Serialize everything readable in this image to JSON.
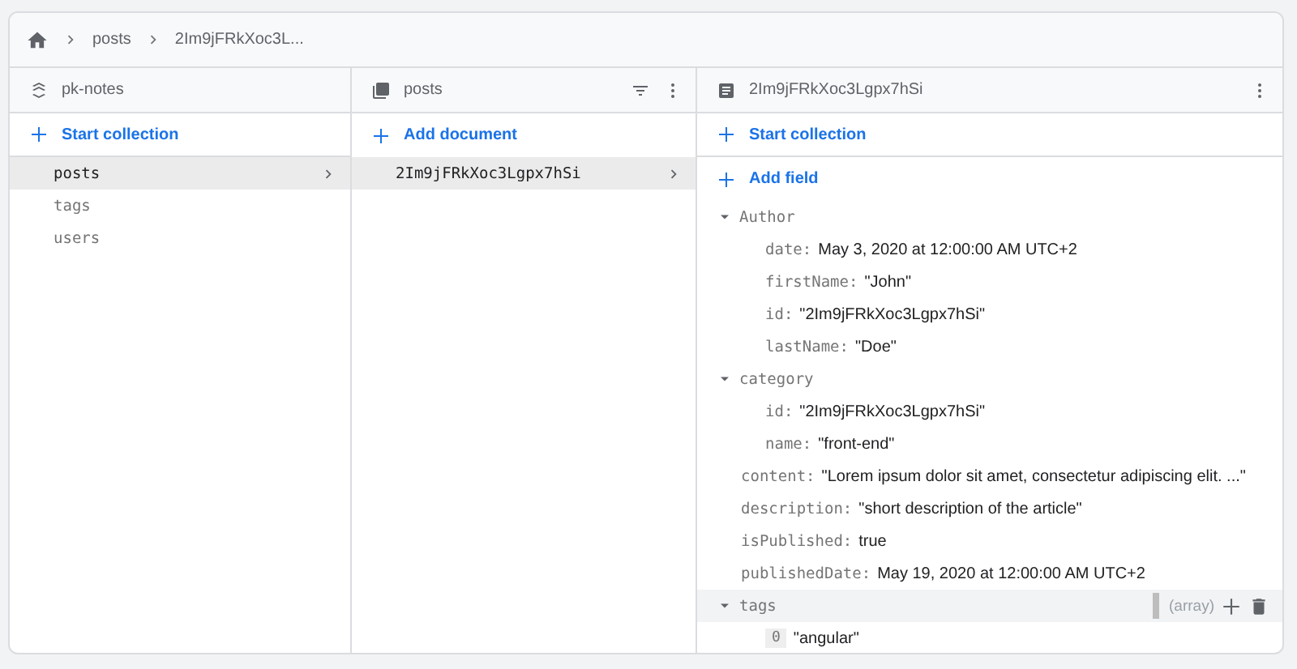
{
  "breadcrumb": [
    "posts",
    "2Im9jFRkXoc3L..."
  ],
  "root_panel": {
    "title": "pk-notes",
    "action": "Start collection",
    "items": [
      {
        "label": "posts",
        "selected": true
      },
      {
        "label": "tags",
        "selected": false
      },
      {
        "label": "users",
        "selected": false
      }
    ]
  },
  "collection_panel": {
    "title": "posts",
    "action": "Add document",
    "items": [
      {
        "label": "2Im9jFRkXoc3Lgpx7hSi",
        "selected": true
      }
    ]
  },
  "document_panel": {
    "title": "2Im9jFRkXoc3Lgpx7hSi",
    "collection_action": "Start collection",
    "field_action": "Add field",
    "fields": [
      {
        "key": "Author",
        "kind": "map",
        "expanded": true,
        "hovered": false,
        "children": [
          {
            "key": "date:",
            "value": "May 3, 2020 at 12:00:00 AM UTC+2"
          },
          {
            "key": "firstName:",
            "value": "\"John\""
          },
          {
            "key": "id:",
            "value": "\"2Im9jFRkXoc3Lgpx7hSi\""
          },
          {
            "key": "lastName:",
            "value": "\"Doe\""
          }
        ]
      },
      {
        "key": "category",
        "kind": "map",
        "expanded": true,
        "hovered": false,
        "children": [
          {
            "key": "id:",
            "value": "\"2Im9jFRkXoc3Lgpx7hSi\""
          },
          {
            "key": "name:",
            "value": "\"front-end\""
          }
        ]
      },
      {
        "key": "content:",
        "kind": "value",
        "value": "\"Lorem ipsum dolor sit amet, consectetur adipiscing elit. ...\""
      },
      {
        "key": "description:",
        "kind": "value",
        "value": "\"short description of the article\""
      },
      {
        "key": "isPublished:",
        "kind": "value",
        "value": "true"
      },
      {
        "key": "publishedDate:",
        "kind": "value",
        "value": "May 19, 2020 at 12:00:00 AM UTC+2"
      },
      {
        "key": "tags",
        "kind": "array",
        "expanded": true,
        "hovered": true,
        "type_label": "(array)",
        "children": [
          {
            "index": "0",
            "value": "\"angular\""
          }
        ]
      }
    ]
  }
}
